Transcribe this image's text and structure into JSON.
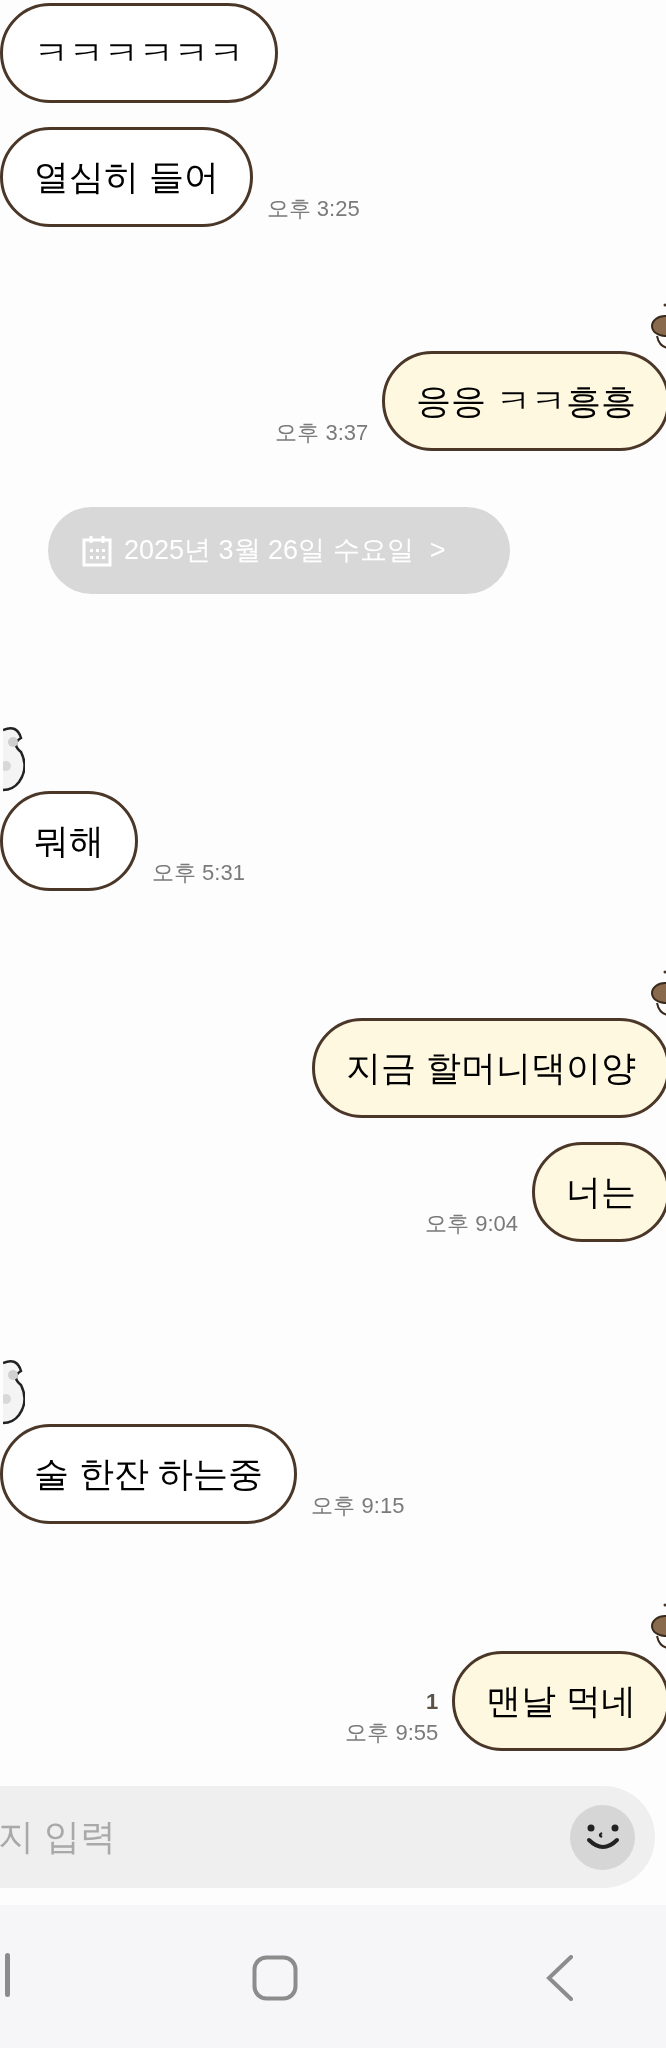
{
  "chat": [
    {
      "kind": "received",
      "decoration": false,
      "messages": [
        "ㅋㅋㅋㅋㅋㅋ",
        "열심히 들어"
      ],
      "time": "오후 3:25"
    },
    {
      "kind": "sent",
      "decoration": true,
      "messages": [
        "응응 ㅋㅋ흥흥"
      ],
      "time": "오후 3:37"
    },
    {
      "kind": "date",
      "text": "2025년 3월 26일 수요일",
      "arrow": ">"
    },
    {
      "kind": "received",
      "decoration": true,
      "messages": [
        "뭐해"
      ],
      "time": "오후 5:31"
    },
    {
      "kind": "sent",
      "decoration": true,
      "messages": [
        "지금 할머니댁이양",
        "너는"
      ],
      "time": "오후 9:04"
    },
    {
      "kind": "received",
      "decoration": true,
      "messages": [
        "술 한잔 하는중"
      ],
      "time": "오후 9:15"
    },
    {
      "kind": "sent",
      "decoration": true,
      "messages": [
        "맨날 먹네"
      ],
      "time": "오후 9:55",
      "unread": "1"
    }
  ],
  "input": {
    "placeholder": "지 입력"
  }
}
